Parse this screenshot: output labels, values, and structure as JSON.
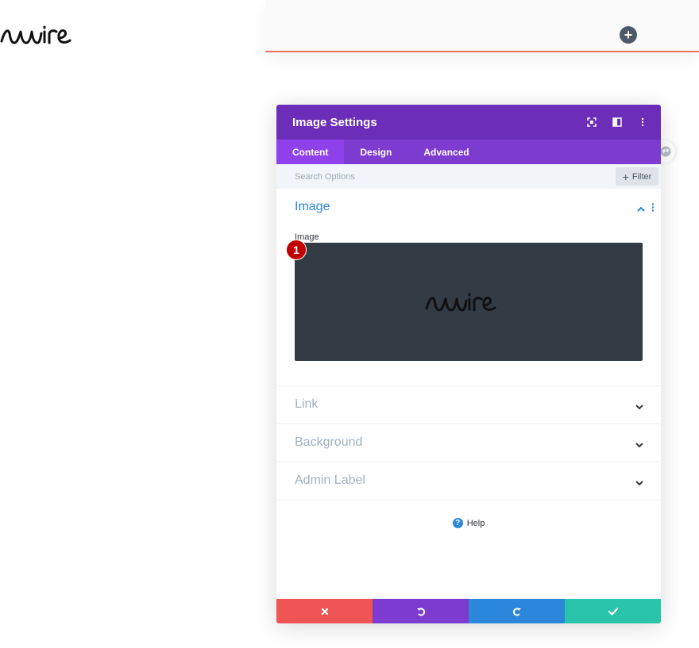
{
  "colors": {
    "header_bg": "#6c2eb9",
    "tab_bar_bg": "#7e3bd0",
    "tab_active_bg": "#8f42ec",
    "accent_blue": "#2b87da",
    "topbar_line": "#e8735a",
    "cancel": "#ef5555",
    "undo": "#7e3bd0",
    "redo": "#2b87da",
    "save": "#29c4a9",
    "image_bg": "#333b45"
  },
  "brand": {
    "logo_text": "wire"
  },
  "topbar": {
    "add_icon": "plus-icon",
    "add_label": "+"
  },
  "modal": {
    "title": "Image Settings",
    "header_icons": [
      "focus-icon",
      "split-view-icon",
      "more-vertical-icon"
    ],
    "tabs": [
      {
        "label": "Content",
        "active": true
      },
      {
        "label": "Design",
        "active": false
      },
      {
        "label": "Advanced",
        "active": false
      }
    ],
    "search": {
      "placeholder": "Search Options",
      "filter_label": "Filter"
    },
    "sections": {
      "image": {
        "title": "Image",
        "field_label": "Image",
        "badge": "1"
      },
      "link": {
        "title": "Link"
      },
      "background": {
        "title": "Background"
      },
      "admin_label": {
        "title": "Admin Label"
      }
    },
    "help": {
      "label": "Help",
      "icon_glyph": "?"
    },
    "footer": [
      "cancel-icon",
      "undo-icon",
      "redo-icon",
      "save-icon"
    ]
  }
}
